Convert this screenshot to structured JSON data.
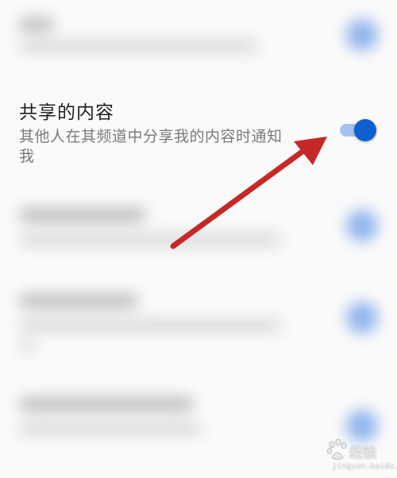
{
  "setting": {
    "title": "共享的内容",
    "description": "其他人在其频道中分享我的内容时通知我",
    "toggle_on": true
  },
  "toggle_colors": {
    "thumb": "#0f5fd0",
    "track": "#a6c2ee"
  },
  "annotation": {
    "arrow_color": "#c62828",
    "points_to": "toggle"
  },
  "watermark": {
    "text": "经验",
    "sub": "jingyan.baidu.com",
    "logo": "baidu-paw-icon"
  }
}
